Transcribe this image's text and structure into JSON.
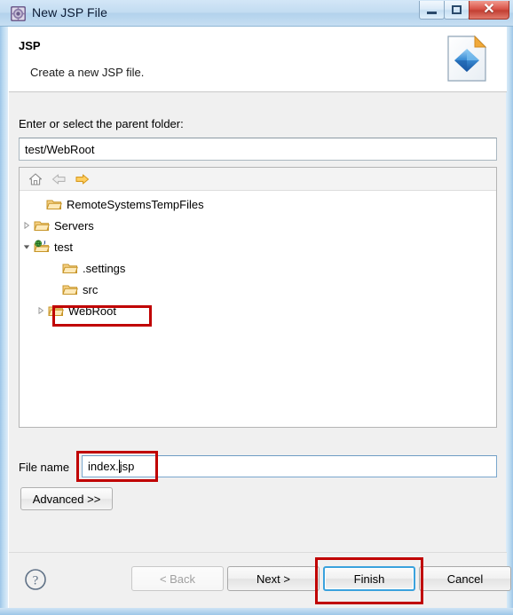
{
  "window": {
    "title": "New JSP File",
    "icon": "jsp-wizard-icon",
    "controls": {
      "minimize": "minimize-icon",
      "restore": "restore-icon",
      "close": "✕"
    }
  },
  "banner": {
    "title": "JSP",
    "description": "Create a new JSP file.",
    "icon": "jsp-file-banner-icon"
  },
  "form": {
    "parent_folder_label": "Enter or select the parent folder:",
    "parent_folder_value": "test/WebRoot",
    "file_name_label": "File name",
    "file_name_value_before_caret": "index.",
    "file_name_value_after_caret": "jsp",
    "file_name_value": "index.jsp",
    "advanced_label": "Advanced >>"
  },
  "tree": {
    "toolbar": [
      {
        "name": "home-icon",
        "enabled": false
      },
      {
        "name": "back-arrow-icon",
        "enabled": false
      },
      {
        "name": "forward-arrow-icon",
        "enabled": true
      }
    ],
    "items": [
      {
        "label": "RemoteSystemsTempFiles",
        "icon": "folder-icon",
        "indent": 1,
        "twisty": "none",
        "highlighted": false
      },
      {
        "label": "Servers",
        "icon": "folder-icon",
        "indent": 0,
        "twisty": "collapsed",
        "highlighted": false
      },
      {
        "label": "test",
        "icon": "web-project-icon",
        "indent": 0,
        "twisty": "expanded",
        "highlighted": false
      },
      {
        "label": ".settings",
        "icon": "folder-icon",
        "indent": 2,
        "twisty": "none",
        "highlighted": false
      },
      {
        "label": "src",
        "icon": "folder-icon",
        "indent": 2,
        "twisty": "none",
        "highlighted": false
      },
      {
        "label": "WebRoot",
        "icon": "folder-icon",
        "indent": 1,
        "twisty": "collapsed",
        "highlighted": true
      }
    ]
  },
  "footer": {
    "help_label": "?",
    "buttons": [
      {
        "id": "back",
        "label": "< Back",
        "enabled": false,
        "focused": false,
        "annotated": false
      },
      {
        "id": "next",
        "label": "Next >",
        "enabled": true,
        "focused": false,
        "annotated": false
      },
      {
        "id": "finish",
        "label": "Finish",
        "enabled": true,
        "focused": true,
        "annotated": true
      },
      {
        "id": "cancel",
        "label": "Cancel",
        "enabled": true,
        "focused": false,
        "annotated": false
      }
    ]
  },
  "annotations": {
    "color": "#c00000",
    "targets": [
      "tree-item-webroot",
      "file-name-input",
      "finish-button"
    ]
  }
}
